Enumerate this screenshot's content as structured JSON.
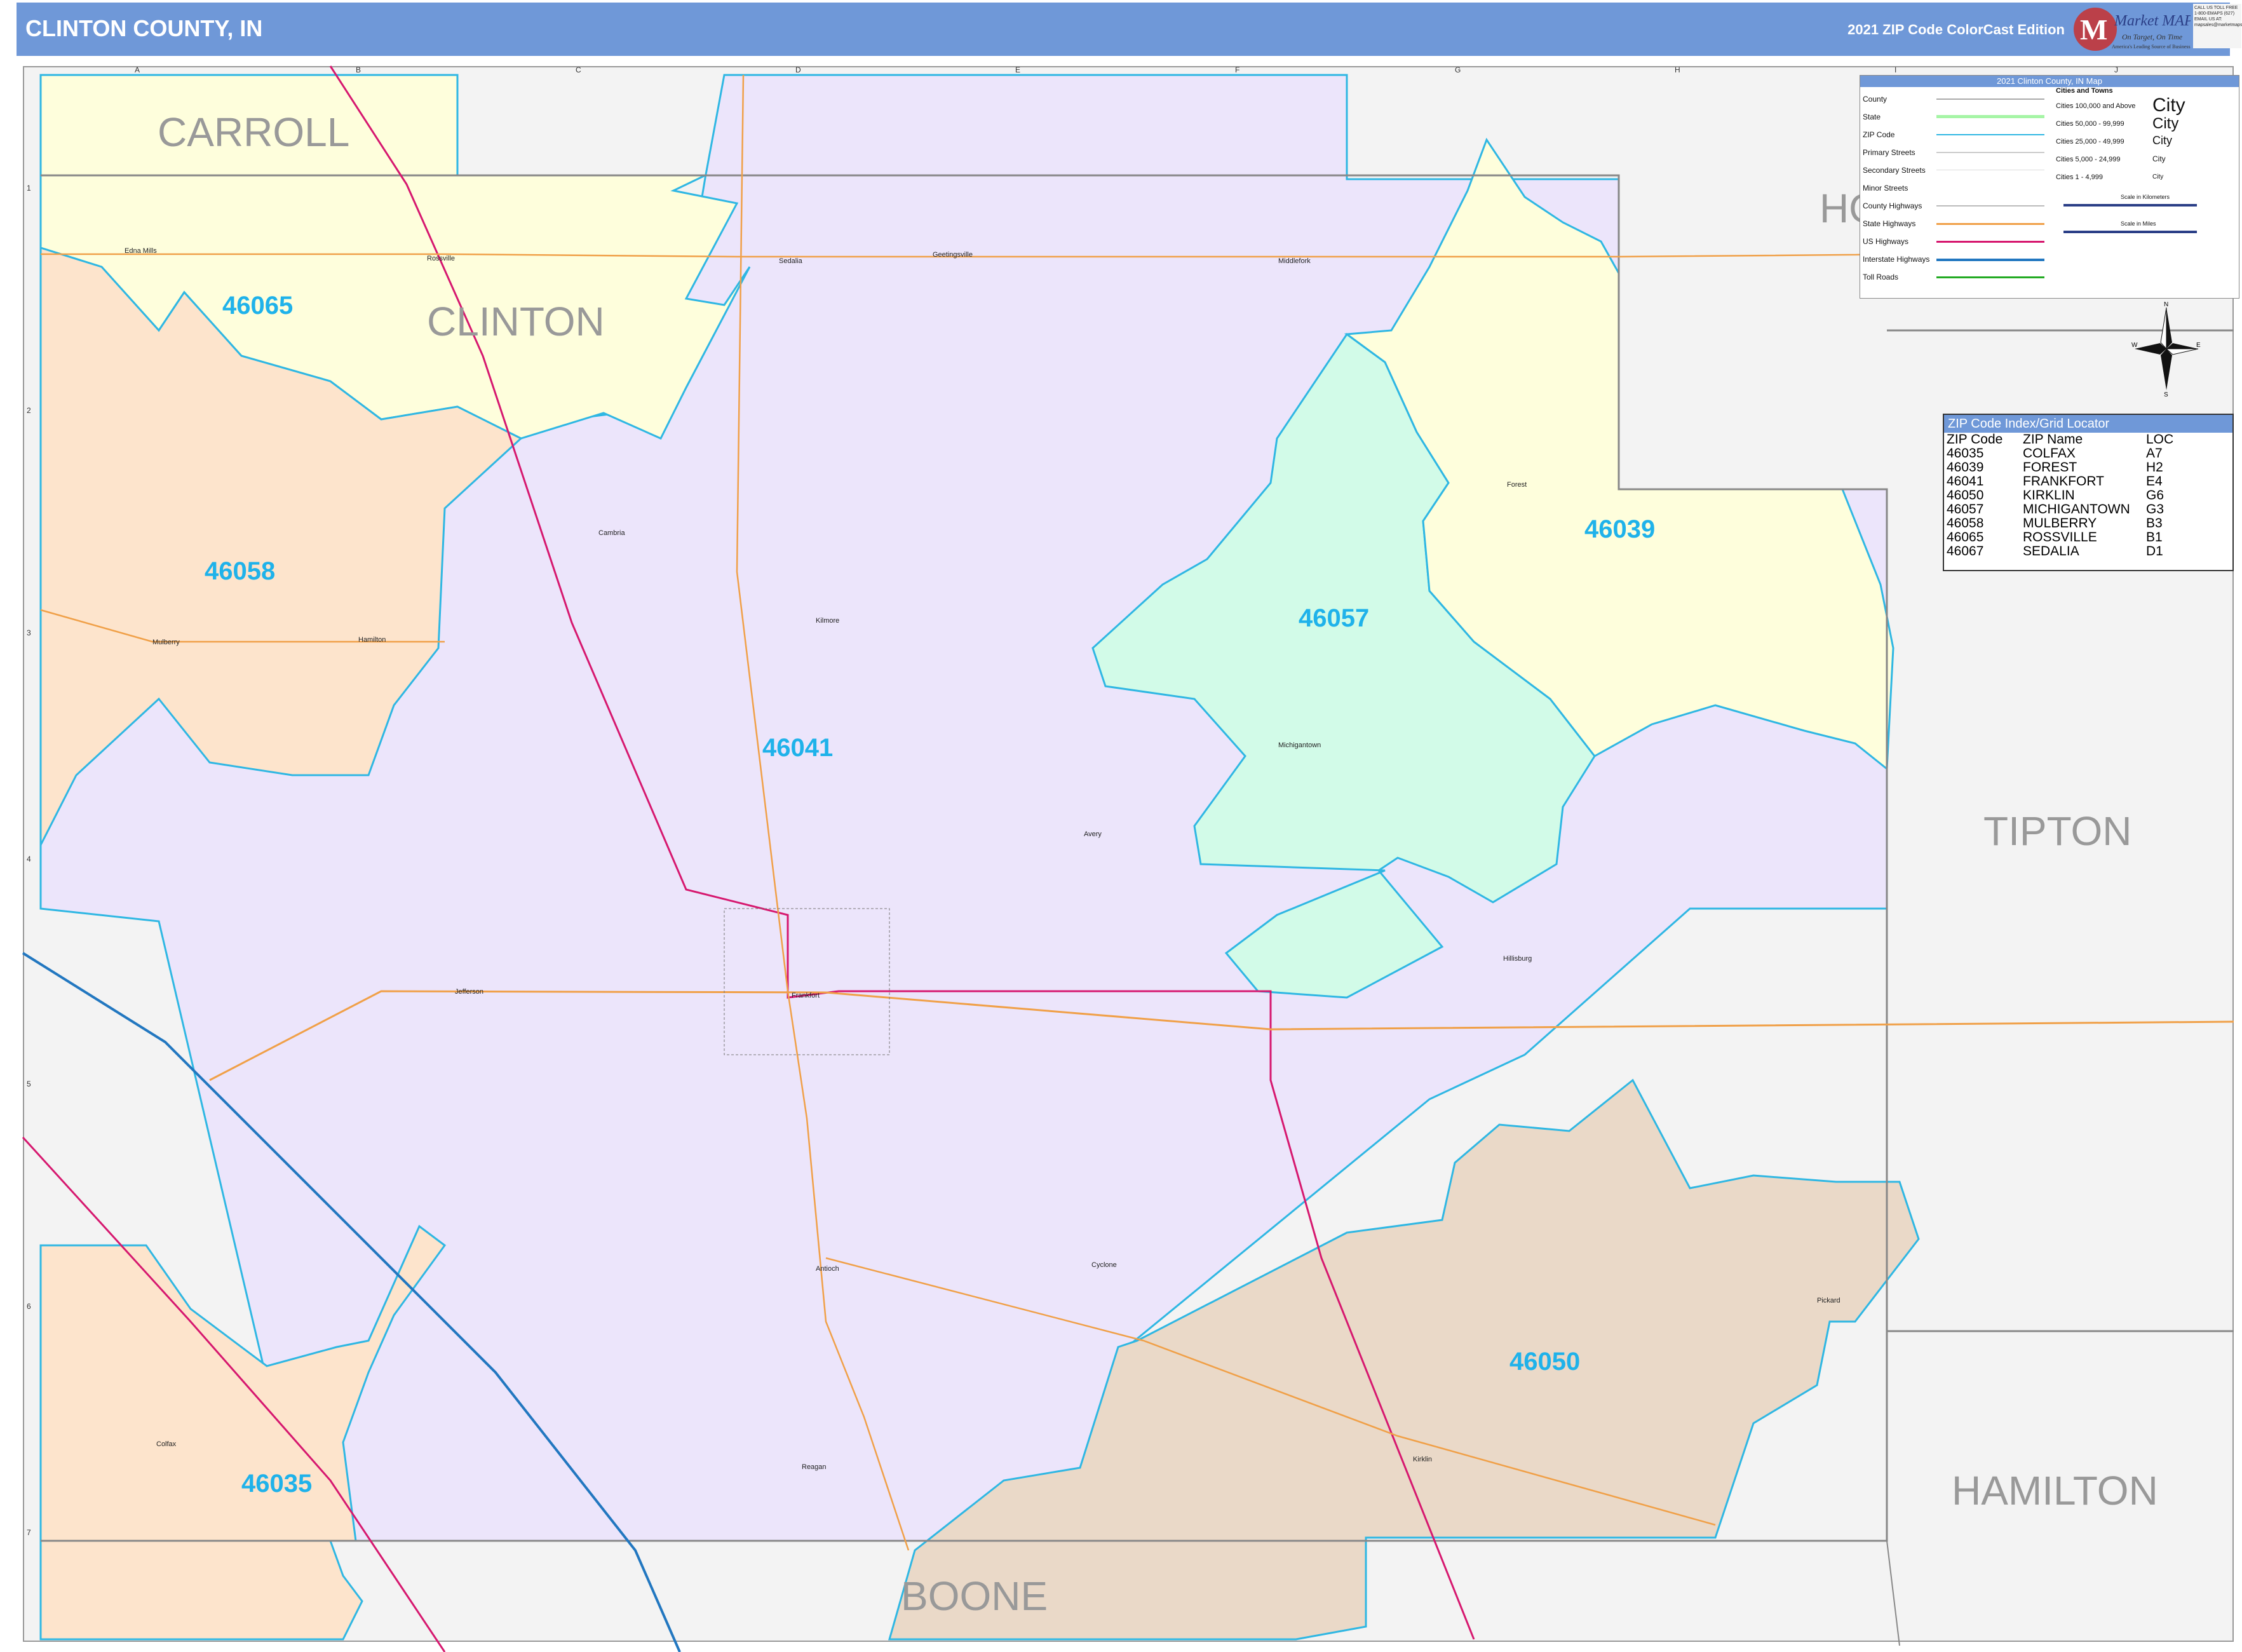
{
  "header": {
    "title": "CLINTON COUNTY, IN",
    "edition": "2021 ZIP Code ColorCast Edition",
    "logo_text": "Market MAPS",
    "logo_tagline": "On Target, On Time",
    "logo_subtag": "America's Leading Source of Business Maps",
    "contact": "CALL US TOLL FREE 1-800-EMAPS (627) EMAIL US AT: mapsales@marketmaps.com"
  },
  "counties": {
    "carroll": "CARROLL",
    "clinton": "CLINTON",
    "tipton": "TIPTON",
    "hamilton": "HAMILTON",
    "boone": "BOONE",
    "howard_partial": "HO"
  },
  "zip_labels": {
    "z46065": "46065",
    "z46058": "46058",
    "z46041": "46041",
    "z46057": "46057",
    "z46039": "46039",
    "z46050": "46050",
    "z46035": "46035"
  },
  "towns": {
    "edna_mills": "Edna Mills",
    "rossville": "Rossville",
    "sedalia": "Sedalia",
    "geetingsville": "Geetingsville",
    "middlefork": "Middlefork",
    "forest": "Forest",
    "cambria": "Cambria",
    "kilmore": "Kilmore",
    "mulberry": "Mulberry",
    "hamilton": "Hamilton",
    "michigantown": "Michigantown",
    "avery": "Avery",
    "jefferson": "Jefferson",
    "frankfort": "Frankfort",
    "hillisburg": "Hillisburg",
    "antioch": "Antioch",
    "cyclone": "Cyclone",
    "pickard": "Pickard",
    "colfax": "Colfax",
    "kirklin": "Kirklin",
    "reagan": "Reagan"
  },
  "grid": {
    "columns": [
      "A",
      "B",
      "C",
      "D",
      "E",
      "F",
      "G",
      "H",
      "I",
      "J"
    ],
    "rows": [
      "1",
      "2",
      "3",
      "4",
      "5",
      "6",
      "7"
    ]
  },
  "legend": {
    "title": "2021 Clinton County, IN Map",
    "items": [
      "County",
      "State",
      "ZIP Code",
      "Primary Streets",
      "Secondary Streets",
      "Minor Streets",
      "County Highways",
      "State Highways",
      "US Highways",
      "Interstate Highways",
      "Toll Roads"
    ],
    "cities_title": "Cities and Towns",
    "cities": [
      "Cities 100,000 and Above",
      "Cities 50,000 - 99,999",
      "Cities 25,000 - 49,999",
      "Cities 5,000 - 24,999",
      "Cities 1 - 4,999"
    ],
    "city_sample": "City",
    "scale_km": "Scale in Kilometers",
    "scale_mi": "Scale in Miles"
  },
  "compass": {
    "n": "N",
    "s": "S",
    "e": "E",
    "w": "W"
  },
  "zip_index": {
    "title": "ZIP Code Index/Grid Locator",
    "headers": [
      "ZIP Code",
      "ZIP Name",
      "LOC"
    ],
    "rows": [
      [
        "46035",
        "COLFAX",
        "A7"
      ],
      [
        "46039",
        "FOREST",
        "H2"
      ],
      [
        "46041",
        "FRANKFORT",
        "E4"
      ],
      [
        "46050",
        "KIRKLIN",
        "G6"
      ],
      [
        "46057",
        "MICHIGANTOWN",
        "G3"
      ],
      [
        "46058",
        "MULBERRY",
        "B3"
      ],
      [
        "46065",
        "ROSSVILLE",
        "B1"
      ],
      [
        "46067",
        "SEDALIA",
        "D1"
      ]
    ]
  },
  "colors": {
    "z46041": "#ece5fb",
    "z46065": "#fefedc",
    "z46058": "#fde4cc",
    "z46057": "#d2fbe8",
    "z46039": "#fefedc",
    "z46050": "#ead9c8",
    "z46035": "#fde4cc",
    "zip_border": "#2fb7e3",
    "zip_label": "#1fb2ea",
    "us_highway": "#d6186f",
    "state_highway": "#f0a048",
    "interstate": "#2277c0",
    "county_label": "#999999"
  }
}
